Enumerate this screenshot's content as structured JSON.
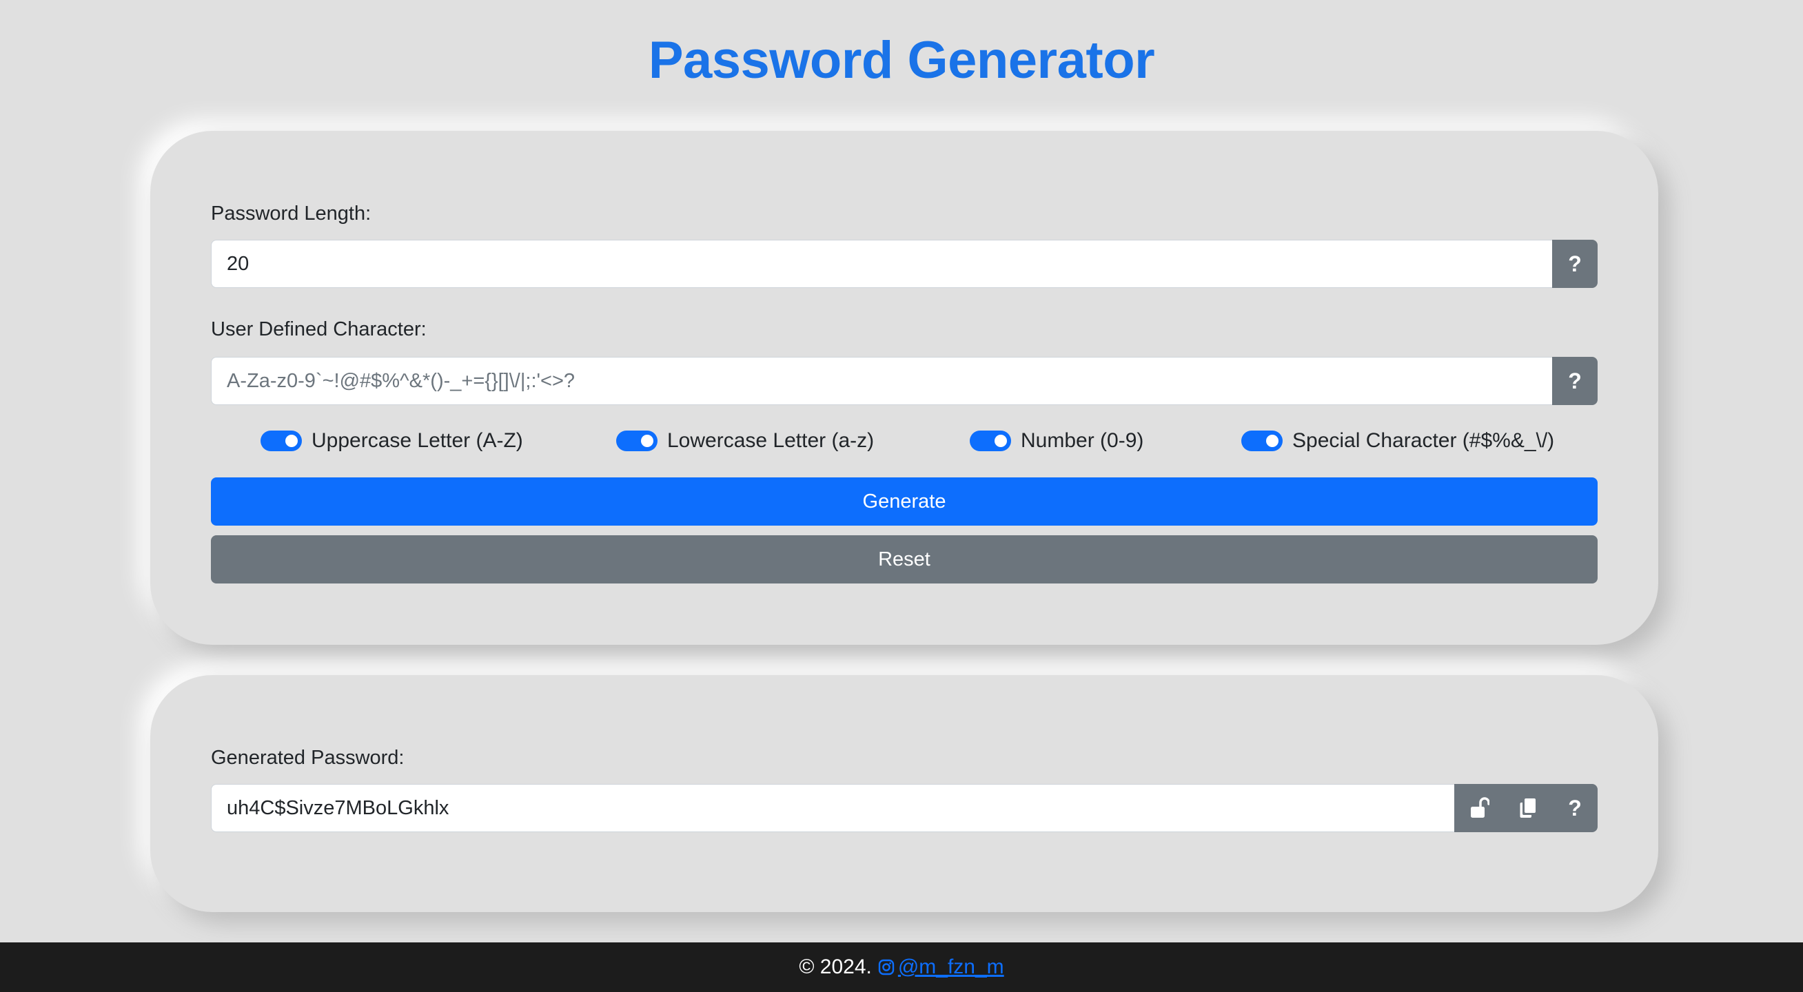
{
  "header": {
    "title": "Password Generator"
  },
  "settings": {
    "length_label": "Password Length:",
    "length_value": "20",
    "length_help": "?",
    "chars_label": "User Defined Character:",
    "chars_placeholder": "A-Za-z0-9`~!@#$%^&*()-_+={}[]\\/|;:'<>?",
    "chars_help": "?",
    "switches": [
      {
        "label": "Uppercase Letter (A-Z)",
        "checked": true
      },
      {
        "label": "Lowercase Letter (a-z)",
        "checked": true
      },
      {
        "label": "Number (0-9)",
        "checked": true
      },
      {
        "label": "Special Character (#$%&_\\/)",
        "checked": true
      }
    ],
    "generate_label": "Generate",
    "reset_label": "Reset"
  },
  "output": {
    "label": "Generated Password:",
    "value": "uh4C$Sivze7MBoLGkhlx",
    "help": "?",
    "icons": {
      "show": "unlock-icon",
      "copy": "copy-icon"
    }
  },
  "footer": {
    "copyright": "© 2024.",
    "link_text": "@m_fzn_m",
    "link_icon": "instagram-icon"
  },
  "colors": {
    "background": "#e0e0e0",
    "title": "#1a73e8",
    "primary": "#0d6efd",
    "secondary": "#6c757d",
    "footer": "#1c1c1c"
  }
}
